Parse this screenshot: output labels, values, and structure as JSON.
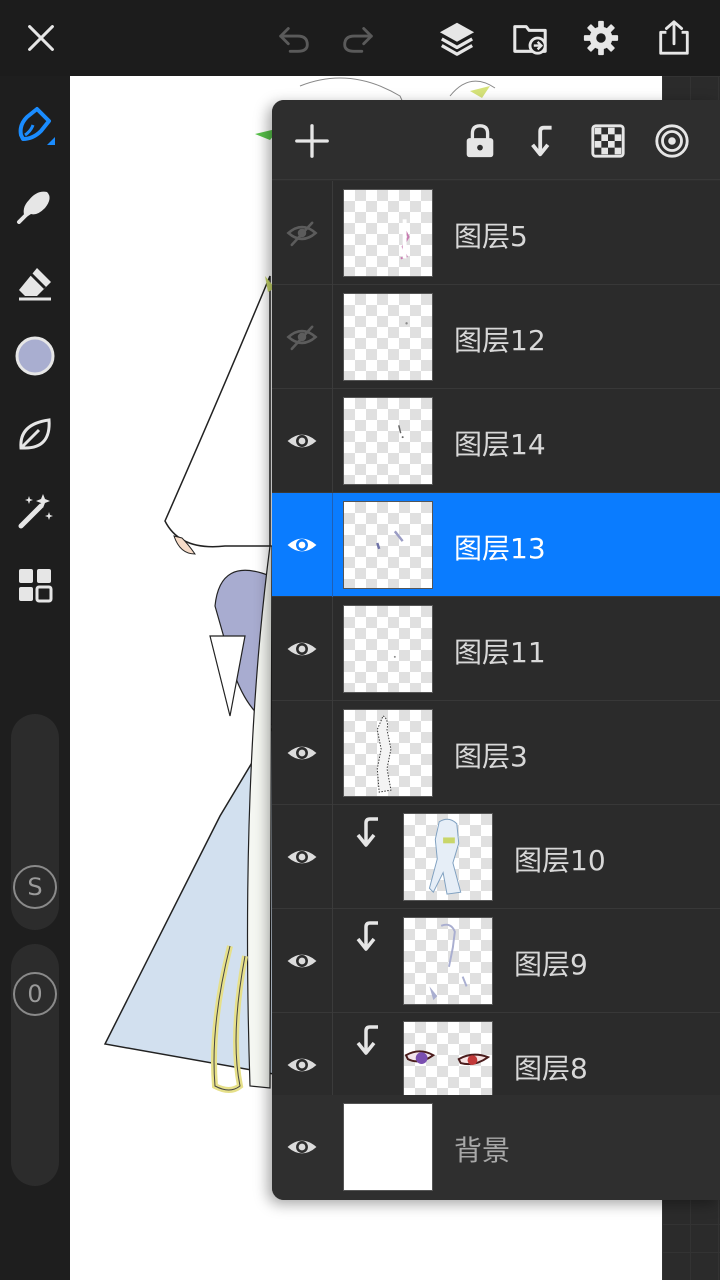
{
  "colors": {
    "accent": "#0a7cff",
    "current_color": "#a9aed0",
    "brush_active": "#1a8cff"
  },
  "topbar": {
    "icons": [
      "close-icon",
      "undo-icon",
      "redo-icon",
      "layers-icon",
      "import-icon",
      "settings-icon",
      "export-icon"
    ]
  },
  "left_toolbar": {
    "tools": [
      "brush-icon",
      "smudge-icon",
      "eraser-icon",
      "color-swatch",
      "leaf-icon",
      "magic-wand-icon",
      "grid-icon"
    ],
    "size_slider_label": "S",
    "opacity_slider_label": "0"
  },
  "layers_panel": {
    "toolbar_icons": [
      "add-layer-icon",
      "lock-icon",
      "clip-icon",
      "checkerboard-icon",
      "blend-icon"
    ],
    "layers": [
      {
        "name": "图层5",
        "visible": false,
        "selected": false,
        "clipped": false
      },
      {
        "name": "图层12",
        "visible": false,
        "selected": false,
        "clipped": false
      },
      {
        "name": "图层14",
        "visible": true,
        "selected": false,
        "clipped": false
      },
      {
        "name": "图层13",
        "visible": true,
        "selected": true,
        "clipped": false
      },
      {
        "name": "图层11",
        "visible": true,
        "selected": false,
        "clipped": false
      },
      {
        "name": "图层3",
        "visible": true,
        "selected": false,
        "clipped": false
      },
      {
        "name": "图层10",
        "visible": true,
        "selected": false,
        "clipped": true
      },
      {
        "name": "图层9",
        "visible": true,
        "selected": false,
        "clipped": true
      },
      {
        "name": "图层8",
        "visible": true,
        "selected": false,
        "clipped": true
      }
    ],
    "background": {
      "name": "背景",
      "visible": true
    }
  }
}
